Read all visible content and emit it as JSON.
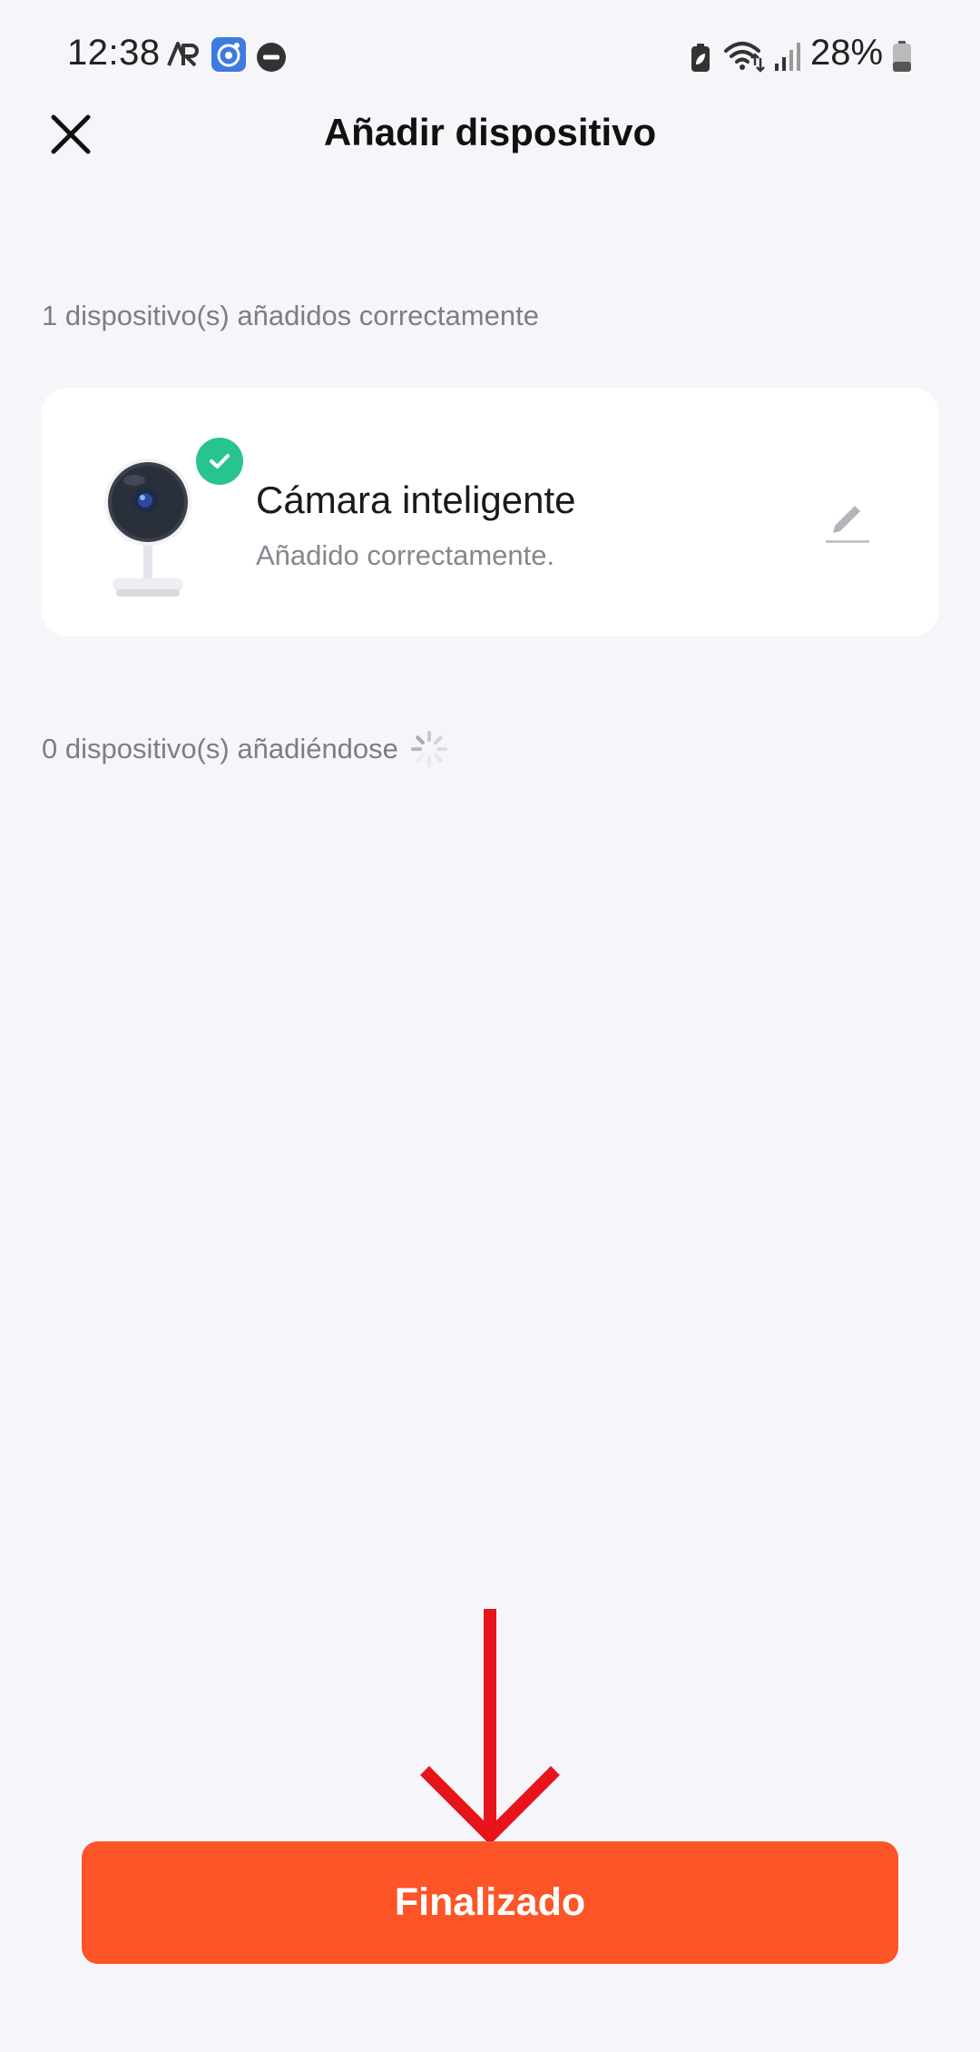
{
  "status_bar": {
    "time": "12:38",
    "battery_percent": "28%",
    "icons": [
      "ar-zone-icon",
      "camera-app-icon",
      "do-not-disturb-icon",
      "battery-saver-icon",
      "wifi-icon",
      "signal-icon",
      "battery-icon"
    ]
  },
  "header": {
    "title": "Añadir dispositivo",
    "close_icon": "close-icon"
  },
  "added_section": {
    "label": "1 dispositivo(s) añadidos correctamente",
    "device": {
      "name": "Cámara inteligente",
      "status": "Añadido correctamente.",
      "image": "smart-camera-image",
      "badge_icon": "check-icon",
      "edit_icon": "pencil-icon"
    }
  },
  "adding_section": {
    "label": "0 dispositivo(s) añadiéndose",
    "spinner_icon": "loading-spinner-icon"
  },
  "footer": {
    "done_label": "Finalizado"
  },
  "colors": {
    "background": "#f6f6fa",
    "accent": "#fd5527",
    "success": "#27c48e",
    "annotation": "#e8141c"
  }
}
